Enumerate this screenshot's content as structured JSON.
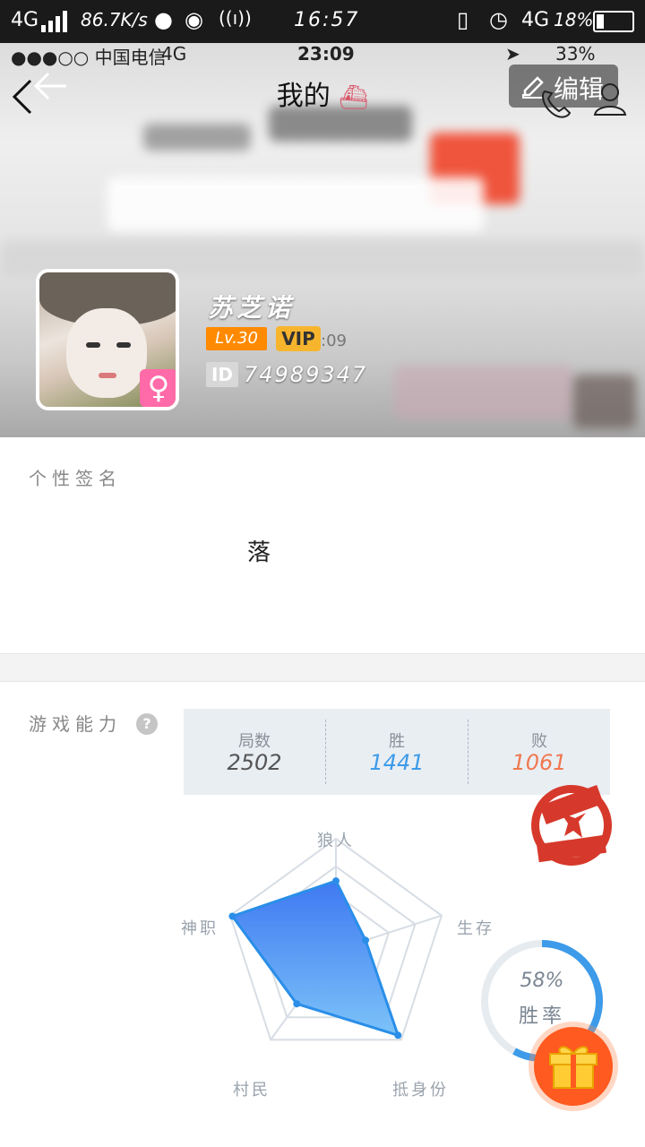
{
  "system_status": {
    "network": "4G",
    "speed": "86.7K/s",
    "time": "16:57",
    "network2": "4G",
    "battery": "18%"
  },
  "ios_status": {
    "carrier": "●●●○○ 中国电信",
    "network": "4G",
    "time": "23:09",
    "battery": "33%"
  },
  "nav": {
    "title": "我的",
    "edit_label": "编辑"
  },
  "profile": {
    "name": "苏芝诺",
    "level": "Lv.30",
    "vip": "VIP",
    "vip_tail": ":09",
    "id_tag": "ID",
    "id_value": "74989347"
  },
  "signature": {
    "label": "个性签名",
    "value": "落"
  },
  "ability": {
    "label": "游戏能力",
    "help": "?",
    "stats": [
      {
        "title": "局数",
        "value": "2502",
        "color": "#555555"
      },
      {
        "title": "胜",
        "value": "1441",
        "color": "#3d9be9"
      },
      {
        "title": "败",
        "value": "1061",
        "color": "#f07850"
      }
    ],
    "radar": {
      "labels": [
        "狼人",
        "生存",
        "抵身份",
        "村民",
        "神职"
      ],
      "values": [
        0.62,
        0.28,
        0.95,
        0.6,
        0.98
      ]
    },
    "win_rate": {
      "percent": "58%",
      "label": "胜率",
      "value": 0.58
    }
  },
  "colors": {
    "accent_blue": "#3d8df5",
    "win_ring": "#3d9be9",
    "loss_orange": "#f07850",
    "lv_orange": "#ff8a00",
    "vip_gold": "#f7b52d"
  }
}
